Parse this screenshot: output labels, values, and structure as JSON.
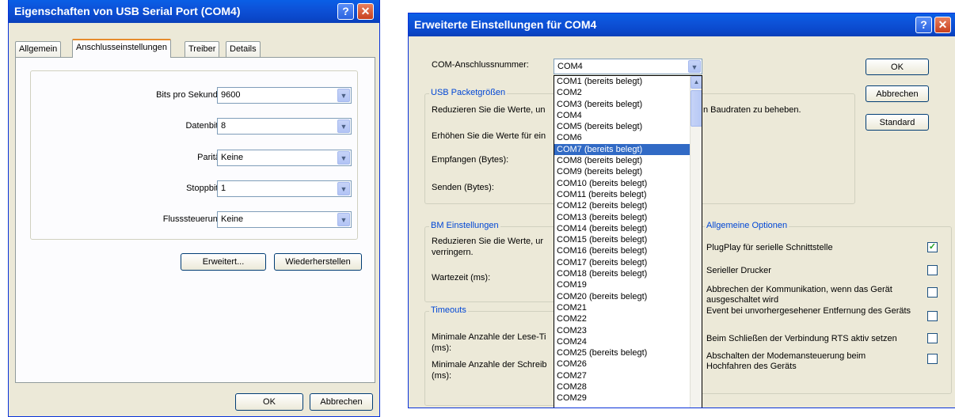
{
  "left_dialog": {
    "title": "Eigenschaften von USB Serial Port (COM4)",
    "tabs": [
      "Allgemein",
      "Anschlusseinstellungen",
      "Treiber",
      "Details"
    ],
    "fields": [
      {
        "label": "Bits pro Sekunde:",
        "value": "9600"
      },
      {
        "label": "Datenbits:",
        "value": "8"
      },
      {
        "label": "Parität:",
        "value": "Keine"
      },
      {
        "label": "Stoppbits:",
        "value": "1"
      },
      {
        "label": "Flusssteuerung:",
        "value": "Keine"
      }
    ],
    "advanced_button": "Erweitert...",
    "restore_button": "Wiederherstellen",
    "ok_button": "OK",
    "cancel_button": "Abbrechen"
  },
  "right_dialog": {
    "title": "Erweiterte Einstellungen für COM4",
    "com_label": "COM-Anschlussnummer:",
    "com_value": "COM4",
    "ok_button": "OK",
    "cancel_button": "Abbrechen",
    "default_button": "Standard",
    "usb_group": {
      "title": "USB Packetgrößen",
      "desc1_a": "Reduzieren Sie die Werte, un",
      "desc1_b": "n Baudraten zu beheben.",
      "desc2": "Erhöhen Sie die Werte für ein",
      "receive_label": "Empfangen (Bytes):",
      "send_label": "Senden (Bytes):"
    },
    "bm_group": {
      "title": "BM Einstellungen",
      "desc_a": "Reduzieren Sie die Werte, ur",
      "desc_b": "verringern.",
      "wait_label": "Wartezeit (ms):"
    },
    "timeouts_group": {
      "title": "Timeouts",
      "read_a": "Minimale Anzahle der Lese-Ti",
      "read_b": "(ms):",
      "write_a": "Minimale Anzahle der Schreib",
      "write_b": "(ms):"
    },
    "general_options": {
      "title": "Allgemeine Optionen",
      "items": [
        {
          "label": "PlugPlay für serielle Schnittstelle",
          "checked": true
        },
        {
          "label": "Serieller Drucker",
          "checked": false
        },
        {
          "label": "Abbrechen der Kommunikation, wenn das Gerät ausgeschaltet wird",
          "checked": false
        },
        {
          "label": "Event bei unvorhergesehener Entfernung des Geräts",
          "checked": false
        },
        {
          "label": "Beim Schließen der Verbindung RTS aktiv setzen",
          "checked": false
        },
        {
          "label": "Abschalten der Modemansteuerung beim Hochfahren des Geräts",
          "checked": false
        }
      ]
    },
    "dropdown_items": [
      "COM1 (bereits belegt)",
      "COM2",
      "COM3 (bereits belegt)",
      "COM4",
      "COM5 (bereits belegt)",
      "COM6",
      "COM7 (bereits belegt)",
      "COM8 (bereits belegt)",
      "COM9 (bereits belegt)",
      "COM10 (bereits belegt)",
      "COM11 (bereits belegt)",
      "COM12 (bereits belegt)",
      "COM13 (bereits belegt)",
      "COM14 (bereits belegt)",
      "COM15 (bereits belegt)",
      "COM16 (bereits belegt)",
      "COM17 (bereits belegt)",
      "COM18 (bereits belegt)",
      "COM19",
      "COM20 (bereits belegt)",
      "COM21",
      "COM22",
      "COM23",
      "COM24",
      "COM25 (bereits belegt)",
      "COM26",
      "COM27",
      "COM28",
      "COM29"
    ],
    "dropdown_selected": "COM7 (bereits belegt)"
  }
}
